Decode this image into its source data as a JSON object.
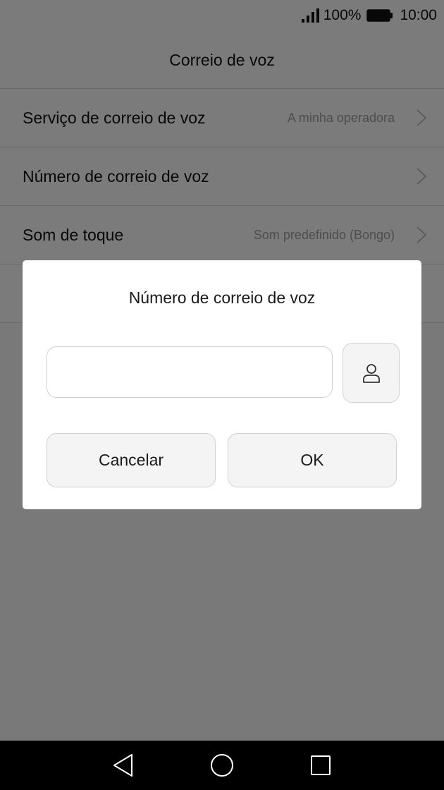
{
  "status_bar": {
    "battery": "100%",
    "time": "10:00",
    "icons": [
      "signal-icon",
      "battery-icon"
    ]
  },
  "header": {
    "title": "Correio de voz"
  },
  "settings": {
    "items": [
      {
        "label": "Serviço de correio de voz",
        "value": "A minha operadora"
      },
      {
        "label": "Número de correio de voz",
        "value": ""
      },
      {
        "label": "Som de toque",
        "value": "Som predefinido (Bongo)"
      }
    ]
  },
  "dialog": {
    "title": "Número de correio de voz",
    "input_value": "",
    "input_placeholder": "",
    "contact_icon": "person-icon",
    "cancel_label": "Cancelar",
    "ok_label": "OK"
  },
  "nav_bar": {
    "icons": [
      "back-icon",
      "home-icon",
      "recents-icon"
    ]
  },
  "colors": {
    "background": "#f7f7f7",
    "dialog": "#ffffff",
    "button_bg": "#f4f4f4",
    "border": "#d0d0d0",
    "nav_bar": "#000000",
    "scrim": "rgba(0,0,0,0.5)"
  }
}
